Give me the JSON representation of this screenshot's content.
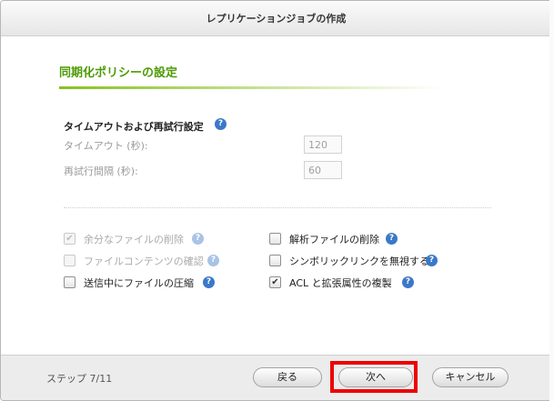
{
  "dialog": {
    "title": "レプリケーションジョブの作成"
  },
  "section": {
    "title": "同期化ポリシーの設定"
  },
  "timeout": {
    "heading": "タイムアウトおよび再試行設定",
    "timeout_label": "タイムアウト (秒):",
    "timeout_value": "120",
    "retry_label": "再試行間隔 (秒):",
    "retry_value": "60"
  },
  "options": {
    "remove_extra_files": {
      "label": "余分なファイルの削除",
      "checked": true,
      "disabled": true
    },
    "verify_content": {
      "label": "ファイルコンテンツの確認",
      "checked": false,
      "disabled": true
    },
    "compress_transfer": {
      "label": "送信中にファイルの圧縮",
      "checked": false,
      "disabled": false
    },
    "delete_sparse": {
      "label": "解析ファイルの削除",
      "checked": false,
      "disabled": false
    },
    "ignore_symlinks": {
      "label": "シンボリックリンクを無視する",
      "checked": false,
      "disabled": false
    },
    "copy_acl": {
      "label": "ACL と拡張属性の複製",
      "checked": true,
      "disabled": false
    }
  },
  "footer": {
    "step": "ステップ 7/11",
    "back": "戻る",
    "next": "次へ",
    "cancel": "キャンセル"
  },
  "colors": {
    "accent_green": "#4e9a06",
    "help_blue": "#3b78c8",
    "highlight_red": "#ee0000"
  },
  "icons": {
    "help": "question-circle",
    "check": "✔"
  }
}
